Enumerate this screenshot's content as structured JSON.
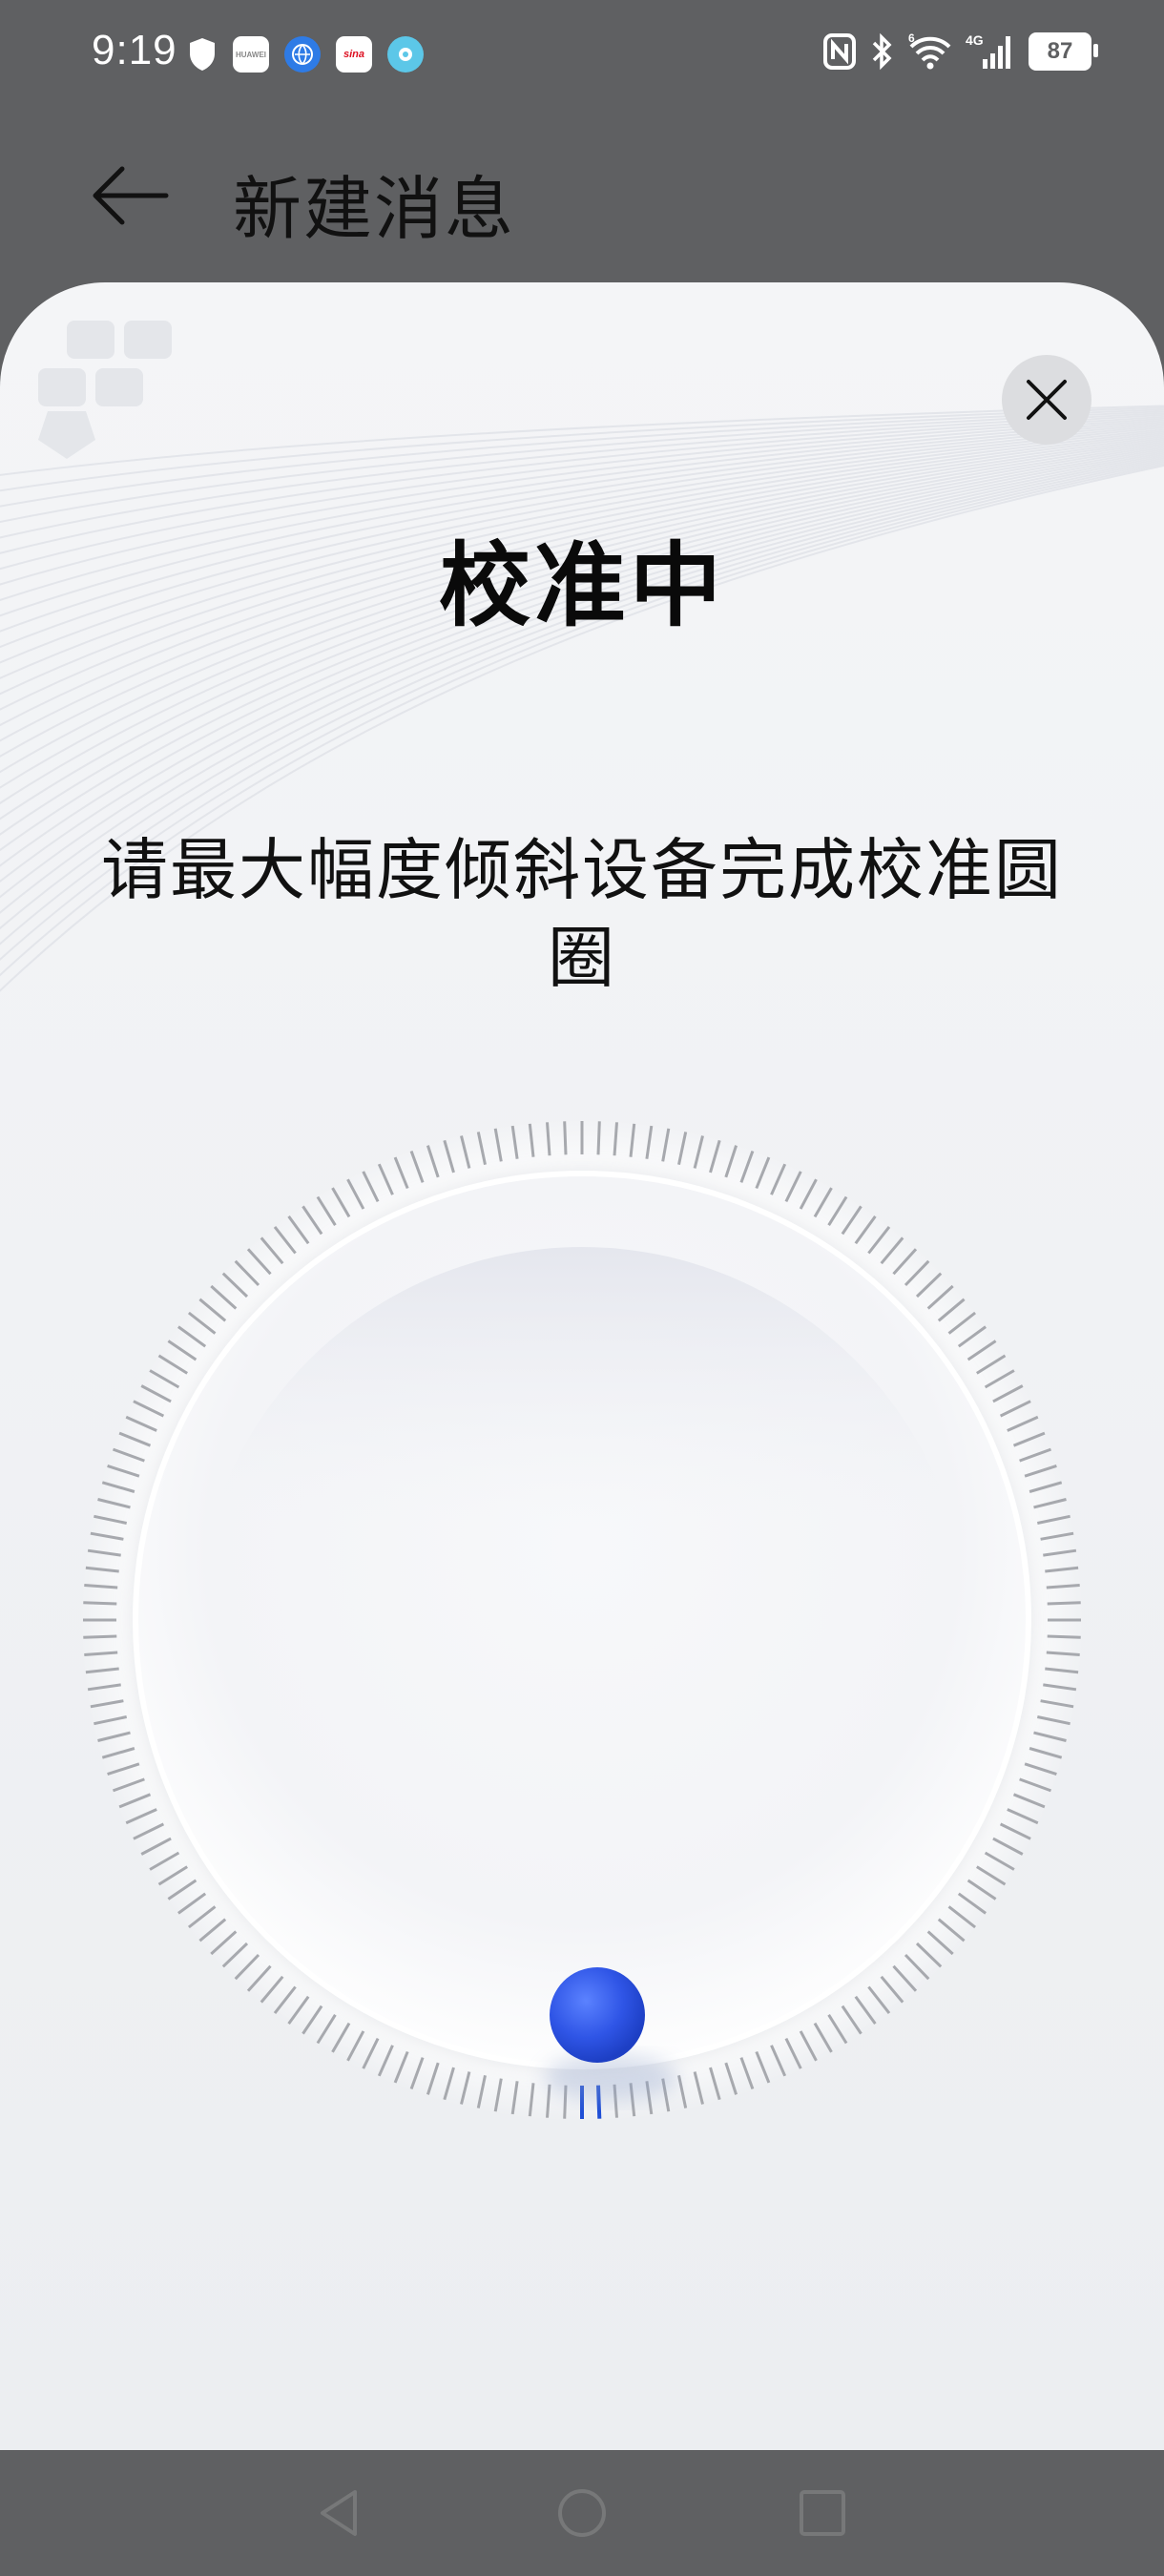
{
  "status_bar": {
    "time": "9:19",
    "battery": "87",
    "network": "4G",
    "wifi_badge": "6",
    "left_icons": [
      "shield-icon",
      "huawei-app-icon",
      "browser-app-icon",
      "sina-app-icon",
      "assistant-app-icon"
    ],
    "right_icons": [
      "nfc-icon",
      "bluetooth-icon",
      "wifi-icon",
      "signal-icon",
      "battery-icon"
    ]
  },
  "header": {
    "title": "新建消息"
  },
  "sheet": {
    "title": "校准中",
    "instruction": "请最大幅度倾斜设备完成校准圆圈"
  },
  "calibration": {
    "progress_fraction": 0.0,
    "indicator_color": "#2f55e6",
    "active_tick_color": "#1f4fd6"
  },
  "nav_bar": {
    "buttons": [
      "back-nav-icon",
      "home-nav-icon",
      "recents-nav-icon"
    ]
  }
}
